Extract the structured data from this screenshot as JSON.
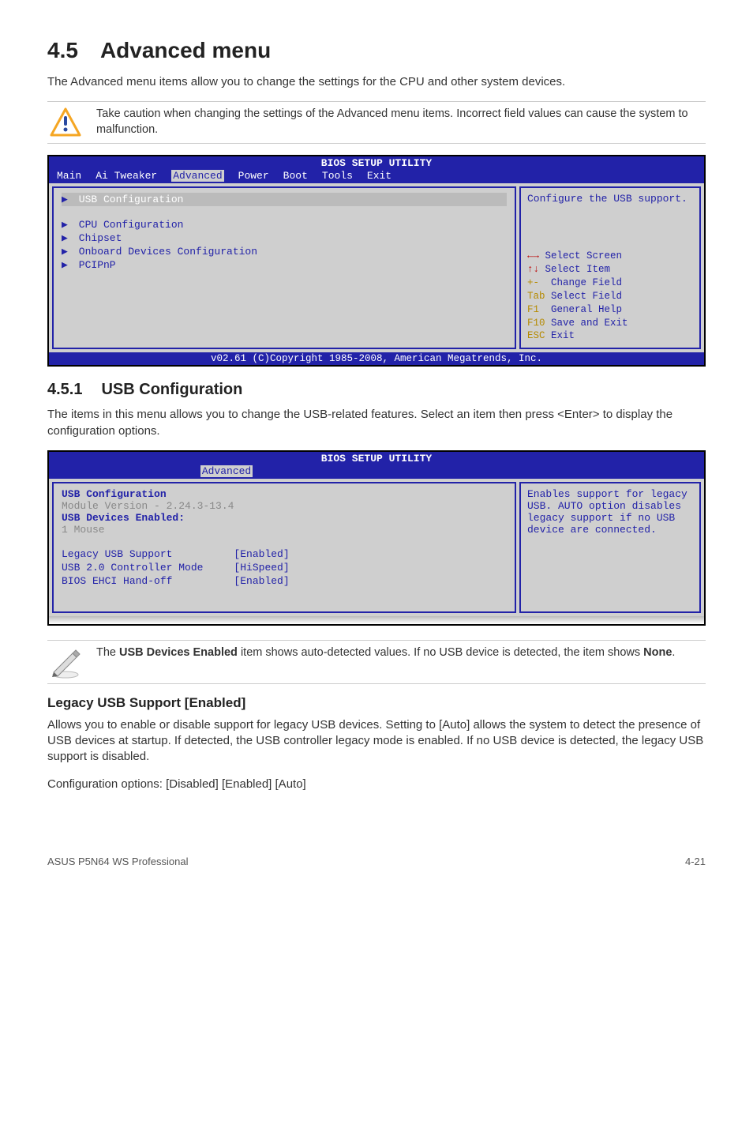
{
  "h1": {
    "num": "4.5",
    "title": "Advanced menu"
  },
  "p_intro": "The Advanced menu items allow you to change the settings for the CPU and other system devices.",
  "caution": "Take caution when changing the settings of the Advanced menu items. Incorrect field values can cause the system to malfunction.",
  "bios1": {
    "title": "BIOS SETUP UTILITY",
    "menu": [
      "Main",
      "Ai Tweaker",
      "Advanced",
      "Power",
      "Boot",
      "Tools",
      "Exit"
    ],
    "menu_active": "Advanced",
    "items": [
      {
        "label": "USB Configuration",
        "selected": true
      },
      {
        "label": "CPU Configuration"
      },
      {
        "label": "Chipset"
      },
      {
        "label": "Onboard Devices Configuration"
      },
      {
        "label": "PCIPnP"
      }
    ],
    "help": "Configure the USB support.",
    "keys": [
      {
        "sym": "←→",
        "txt": " Select Screen"
      },
      {
        "sym": "↑↓",
        "txt": " Select Item"
      },
      {
        "sym": "+- ",
        "txt": " Change Field"
      },
      {
        "sym": "Tab",
        "txt": " Select Field"
      },
      {
        "sym": "F1 ",
        "txt": " General Help"
      },
      {
        "sym": "F10",
        "txt": " Save and Exit"
      },
      {
        "sym": "ESC",
        "txt": " Exit"
      }
    ],
    "footer": "v02.61 (C)Copyright 1985-2008, American Megatrends, Inc."
  },
  "h2": {
    "num": "4.5.1",
    "title": "USB Configuration"
  },
  "p_usbconf": "The items in this menu allows you to change the USB-related features. Select an item then press <Enter> to display the configuration options.",
  "bios2": {
    "title": "BIOS SETUP UTILITY",
    "menu_active": "Advanced",
    "section": "USB Configuration",
    "grey_line": "Module Version - 2.24.3-13.4",
    "sub_label": "USB Devices Enabled:",
    "sub_value": " 1 Mouse",
    "settings": [
      {
        "name": "Legacy USB Support",
        "value": "[Enabled]"
      },
      {
        "name": "USB 2.0 Controller Mode",
        "value": "[HiSpeed]"
      },
      {
        "name": "BIOS EHCI Hand-off",
        "value": "[Enabled]"
      }
    ],
    "help": "Enables support for legacy USB. AUTO option disables legacy support if no USB device are connected."
  },
  "pencil_note_pre": "The ",
  "pencil_note_bold1": "USB Devices Enabled",
  "pencil_note_mid": " item shows auto-detected values. If no USB device is detected, the item shows ",
  "pencil_note_bold2": "None",
  "pencil_note_end": ".",
  "h3": "Legacy USB Support [Enabled]",
  "p_legacy1": "Allows you to enable or disable support for legacy USB devices. Setting to [Auto] allows the system to detect the presence of USB devices at startup. If detected, the USB controller legacy mode is enabled. If no USB device is detected, the legacy USB support is disabled.",
  "p_legacy2": "Configuration options: [Disabled] [Enabled] [Auto]",
  "footer_left": "ASUS P5N64 WS Professional",
  "footer_right": "4-21"
}
